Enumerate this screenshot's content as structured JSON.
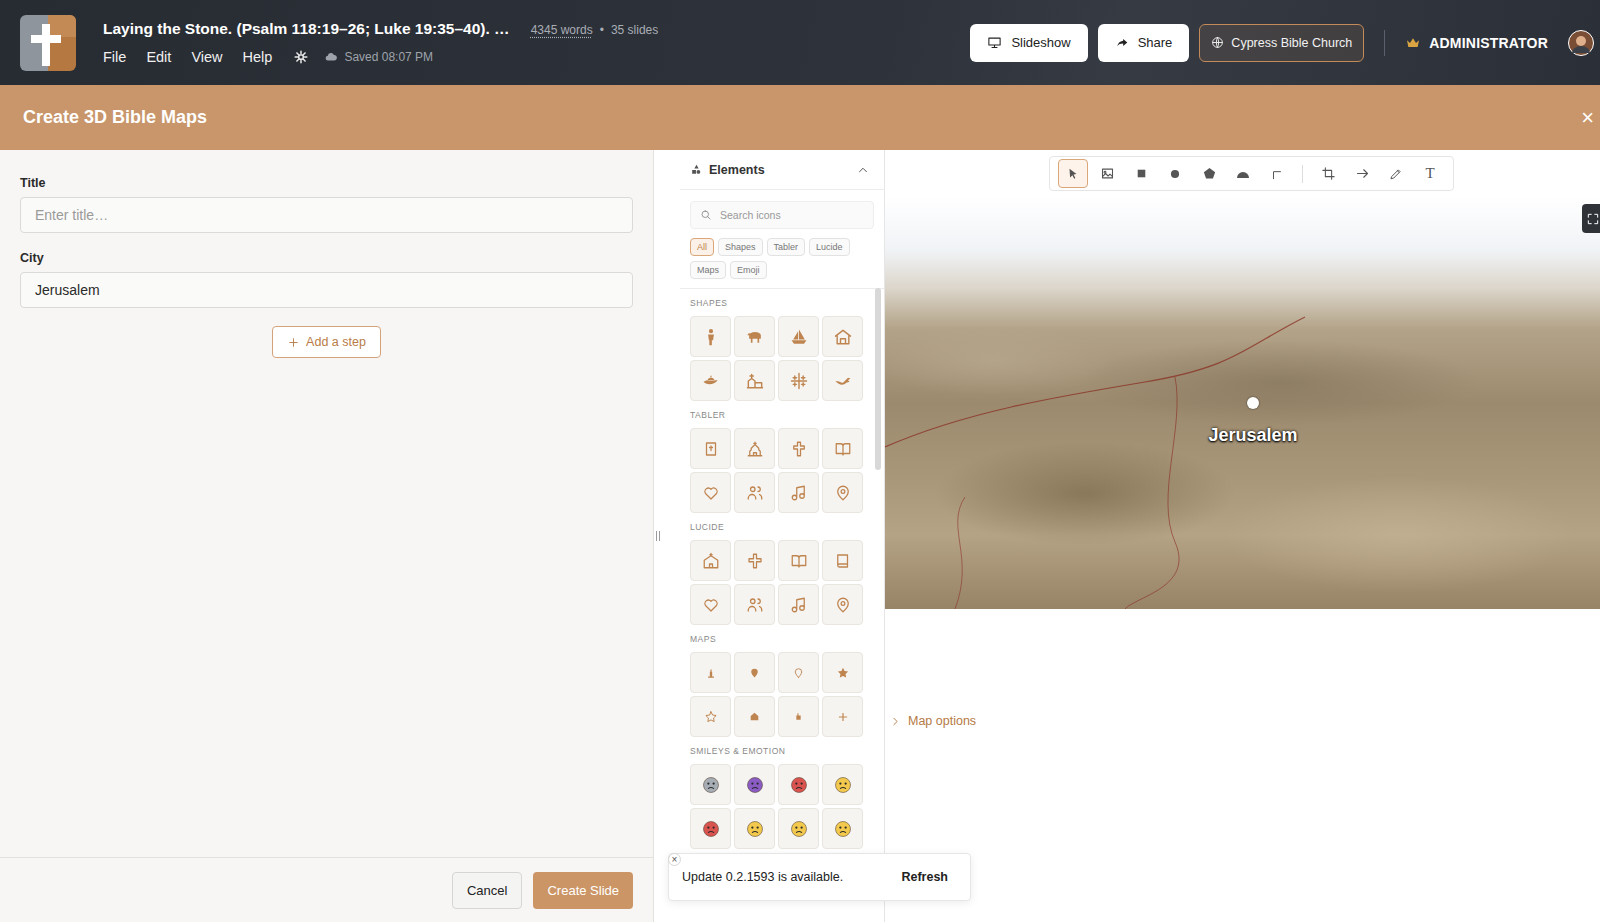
{
  "app": {
    "title": "Laying the Stone. (Psalm 118:19–26; Luke 19:35–40). …",
    "word_count": "4345 words",
    "separator": "•",
    "slide_count": "35 slides",
    "save_status": "Saved 08:07 PM"
  },
  "menu": [
    "File",
    "Edit",
    "View",
    "Help"
  ],
  "header_buttons": [
    {
      "label": "Slideshow",
      "kind": "monitor"
    },
    {
      "label": "Share",
      "kind": "share"
    }
  ],
  "org": "Cypress Bible Church",
  "role": "ADMINISTRATOR",
  "panel": {
    "title": "Create 3D Bible Maps",
    "close": "×"
  },
  "form": {
    "fields": [
      {
        "label": "Title",
        "value": "",
        "placeholder": "Enter title…"
      },
      {
        "label": "City",
        "value": "Jerusalem"
      }
    ],
    "add_step": "Add a step",
    "cancel": "Cancel",
    "submit": "Create Slide"
  },
  "elements": {
    "title": "Elements",
    "search_placeholder": "Search icons",
    "filters": [
      {
        "label": "All",
        "selected": true
      },
      {
        "label": "Shapes",
        "selected": false
      },
      {
        "label": "Tabler",
        "selected": false
      },
      {
        "label": "Lucide",
        "selected": false
      },
      {
        "label": "Maps",
        "selected": false
      },
      {
        "label": "Emoji",
        "selected": false
      }
    ],
    "sections": [
      {
        "title": "SHAPES",
        "icons": [
          {
            "kind": "person"
          },
          {
            "kind": "sheep"
          },
          {
            "kind": "boat"
          },
          {
            "kind": "house"
          },
          {
            "kind": "lamp"
          },
          {
            "kind": "temple"
          },
          {
            "kind": "jcross"
          },
          {
            "kind": "dove"
          }
        ]
      },
      {
        "title": "TABLER",
        "icons": [
          {
            "kind": "bible"
          },
          {
            "kind": "church"
          },
          {
            "kind": "cross"
          },
          {
            "kind": "book"
          },
          {
            "kind": "heart"
          },
          {
            "kind": "users"
          },
          {
            "kind": "music"
          },
          {
            "kind": "pin"
          }
        ]
      },
      {
        "title": "LUCIDE",
        "icons": [
          {
            "kind": "lchurch"
          },
          {
            "kind": "lcross"
          },
          {
            "kind": "book"
          },
          {
            "kind": "lbook"
          },
          {
            "kind": "heart"
          },
          {
            "kind": "users"
          },
          {
            "kind": "music"
          },
          {
            "kind": "pin"
          }
        ]
      },
      {
        "title": "MAPS",
        "icons": [
          {
            "kind": "monument"
          },
          {
            "kind": "mpin"
          },
          {
            "kind": "mpin2"
          },
          {
            "kind": "star"
          },
          {
            "kind": "star2"
          },
          {
            "kind": "home"
          },
          {
            "kind": "flag"
          },
          {
            "kind": "mplus"
          }
        ]
      },
      {
        "title": "SMILEYS & EMOTION",
        "icons": [
          {
            "kind": "face",
            "color": "#a7adb4"
          },
          {
            "kind": "face",
            "color": "#8a5cc4"
          },
          {
            "kind": "face",
            "color": "#d9534f"
          },
          {
            "kind": "face",
            "color": "#f2c94c"
          },
          {
            "kind": "face",
            "color": "#d9534f"
          },
          {
            "kind": "face",
            "color": "#f2c94c"
          },
          {
            "kind": "face",
            "color": "#f2c94c"
          },
          {
            "kind": "face",
            "color": "#f2c94c"
          }
        ]
      }
    ]
  },
  "tool_groups": [
    [
      {
        "kind": "pointer",
        "selected": true
      },
      {
        "kind": "image",
        "selected": false
      },
      {
        "kind": "rect",
        "selected": false
      },
      {
        "kind": "circle",
        "selected": false
      },
      {
        "kind": "pentagon",
        "selected": false
      },
      {
        "kind": "arc",
        "selected": false
      },
      {
        "kind": "elbow",
        "selected": false
      }
    ],
    [
      {
        "kind": "crop",
        "selected": false
      },
      {
        "kind": "arrow",
        "selected": false
      },
      {
        "kind": "pen",
        "selected": false
      },
      {
        "kind": "text",
        "label": "T",
        "selected": false
      }
    ]
  ],
  "map": {
    "pin_label": "Jerusalem",
    "options": "Map options"
  },
  "toast": {
    "message": "Update 0.2.1593 is available.",
    "action": "Refresh",
    "close": "×"
  }
}
